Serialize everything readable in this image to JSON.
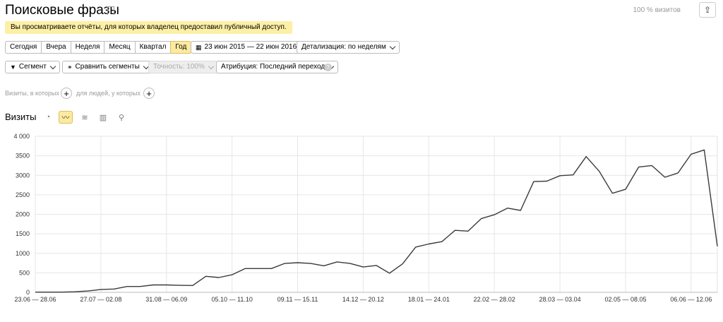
{
  "header": {
    "title": "Поисковые фразы",
    "visits_pct": "100 % визитов",
    "notice": "Вы просматриваете отчёты, для которых владелец предоставил публичный доступ."
  },
  "period": {
    "buttons": [
      "Сегодня",
      "Вчера",
      "Неделя",
      "Месяц",
      "Квартал",
      "Год"
    ],
    "active": "Год",
    "date_range": "23 июн 2015 — 22 июн 2016",
    "detail_label": "Детализация: по неделям"
  },
  "filters": {
    "segment": "Сегмент",
    "compare": "Сравнить сегменты",
    "accuracy": "Точность: 100%",
    "attribution": "Атрибуция: Последний переход",
    "help": "?"
  },
  "segment_builder": {
    "visits_text": "Визиты, в которых",
    "people_text": "для людей, у которых"
  },
  "chart_header": {
    "title": "Визиты"
  },
  "chart_data": {
    "type": "line",
    "title": "",
    "xlabel": "",
    "ylabel": "",
    "ylim": [
      0,
      4000
    ],
    "yticks": [
      "0",
      "500",
      "1000",
      "1500",
      "2000",
      "2500",
      "3000",
      "3500",
      "4 000"
    ],
    "ytick_values": [
      0,
      500,
      1000,
      1500,
      2000,
      2500,
      3000,
      3500,
      4000
    ],
    "x_tick_labels": [
      "23.06 — 28.06",
      "27.07 — 02.08",
      "31.08 — 06.09",
      "05.10 — 11.10",
      "09.11 — 15.11",
      "14.12 — 20.12",
      "18.01 — 24.01",
      "22.02 — 28.02",
      "28.03 — 03.04",
      "02.05 — 08.05",
      "06.06 — 12.06"
    ],
    "x_tick_indices": [
      0,
      5,
      10,
      15,
      20,
      25,
      30,
      35,
      40,
      45,
      50
    ],
    "grid": true,
    "series": [
      {
        "values": [
          5,
          5,
          5,
          15,
          35,
          75,
          85,
          150,
          150,
          190,
          190,
          180,
          175,
          410,
          380,
          450,
          610,
          610,
          610,
          740,
          760,
          740,
          680,
          780,
          740,
          650,
          690,
          490,
          730,
          1160,
          1240,
          1300,
          1590,
          1570,
          1890,
          1990,
          2160,
          2100,
          2840,
          2850,
          2990,
          3010,
          3480,
          3100,
          2540,
          2640,
          3210,
          3250,
          2950,
          3060,
          3540,
          3650,
          1180
        ],
        "color": "#3a3a3a"
      }
    ]
  }
}
